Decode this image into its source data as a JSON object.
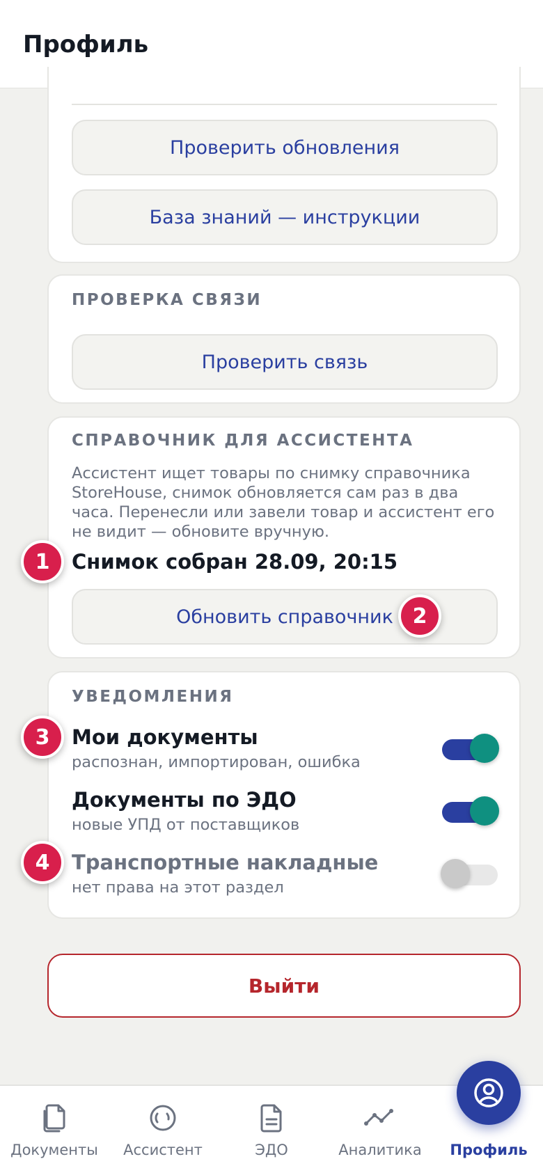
{
  "header": {
    "title": "Профиль"
  },
  "updates_card": {
    "check_updates_label": "Проверить обновления",
    "knowledge_base_label": "База знаний — инструкции"
  },
  "connection_card": {
    "title": "ПРОВЕРКА СВЯЗИ",
    "check_connection_label": "Проверить связь"
  },
  "reference_card": {
    "title": "СПРАВОЧНИК ДЛЯ АССИСТЕНТА",
    "description": "Ассистент ищет товары по снимку справочника StoreHouse, снимок обновляется сам раз в два часа. Перенесли или завели товар и ассистент его не видит — обновите вручную.",
    "snapshot_text": "Снимок собран 28.09, 20:15",
    "refresh_label": "Обновить справочник"
  },
  "notifications_card": {
    "title": "УВЕДОМЛЕНИЯ",
    "items": [
      {
        "title": "Мои документы",
        "subtitle": "распознан, импортирован, ошибка",
        "enabled": true,
        "disabled": false
      },
      {
        "title": "Документы по ЭДО",
        "subtitle": "новые УПД от поставщиков",
        "enabled": true,
        "disabled": false
      },
      {
        "title": "Транспортные накладные",
        "subtitle": "нет права на этот раздел",
        "enabled": false,
        "disabled": true
      }
    ]
  },
  "badges": [
    "1",
    "2",
    "3",
    "4"
  ],
  "logout_label": "Выйти",
  "tabs": [
    {
      "label": "Документы",
      "icon": "documents-icon",
      "active": false
    },
    {
      "label": "Ассистент",
      "icon": "assistant-icon",
      "active": false
    },
    {
      "label": "ЭДО",
      "icon": "edo-icon",
      "active": false
    },
    {
      "label": "Аналитика",
      "icon": "analytics-icon",
      "active": false
    },
    {
      "label": "Профиль",
      "icon": "profile-icon",
      "active": true
    }
  ],
  "colors": {
    "accent": "#2a3fa0",
    "toggle_knob_on": "#0f9080",
    "badge": "#d81f4c",
    "logout": "#b5262c",
    "background": "#f1f1ee"
  }
}
